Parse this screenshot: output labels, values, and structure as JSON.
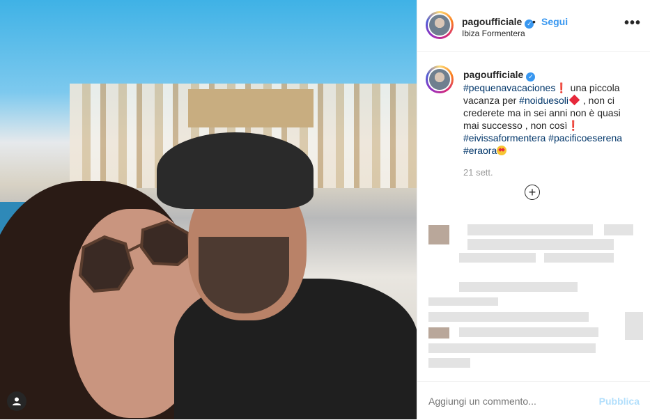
{
  "post": {
    "username": "pagoufficiale",
    "follow_label": "Segui",
    "separator": "•",
    "location": "Ibiza Formentera",
    "more_label": "•••"
  },
  "caption": {
    "username": "pagoufficiale",
    "tag1": "#pequenavacaciones",
    "text1": " una piccola vacanza per ",
    "tag2": "#noiduesoli",
    "text2": " , non ci crederete ma in sei anni non è quasi mai successo , non così",
    "tag3": "#eivissaformentera",
    "tag4": "#pacificoeserena",
    "tag5": "#eraora",
    "time": "21 sett."
  },
  "load_more_label": "+",
  "comment": {
    "placeholder": "Aggiungi un commento...",
    "post_label": "Pubblica"
  },
  "colors": {
    "accent": "#3897f0",
    "hashtag": "#003569",
    "post_disabled": "#b2dffc"
  },
  "icons": [
    "verified-badge-icon",
    "more-options-icon",
    "plus-circle-icon",
    "user-tag-icon",
    "heart-emoji-icon",
    "exclamation-emoji-icon",
    "heart-eyes-emoji-icon"
  ]
}
